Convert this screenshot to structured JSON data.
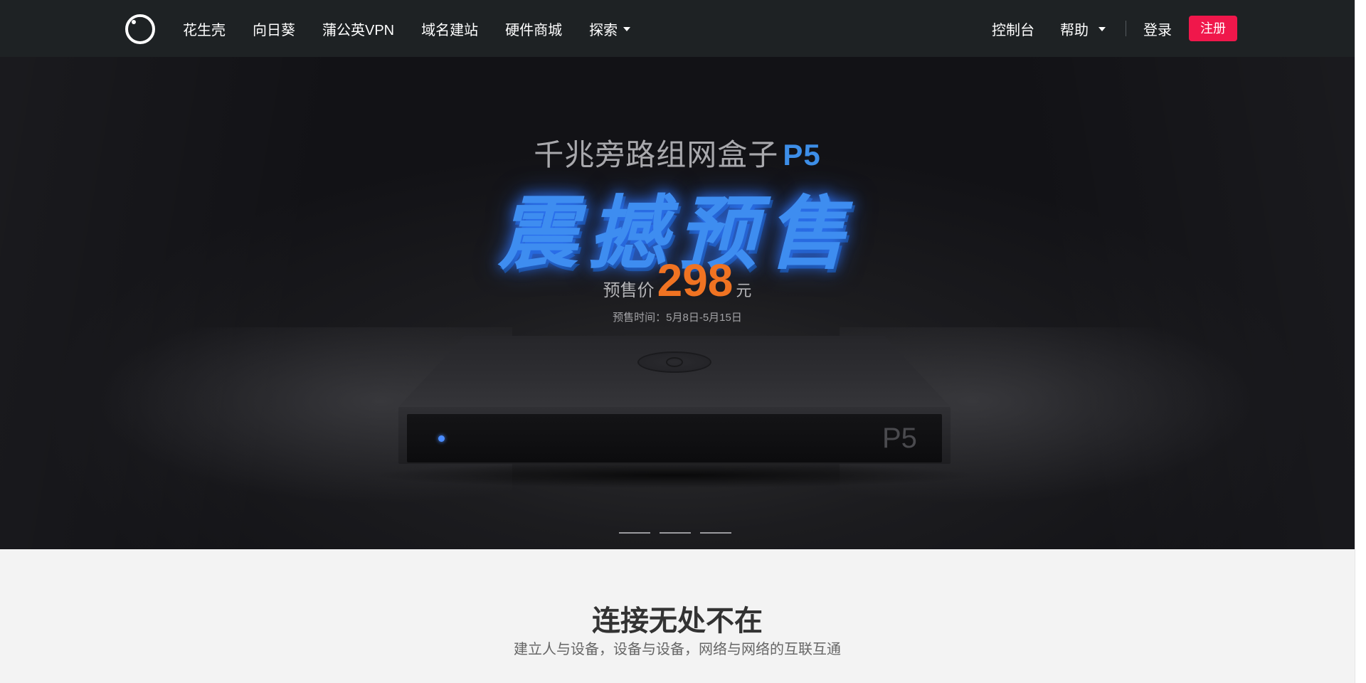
{
  "nav": {
    "items": [
      {
        "label": "花生壳"
      },
      {
        "label": "向日葵"
      },
      {
        "label": "蒲公英VPN"
      },
      {
        "label": "域名建站"
      },
      {
        "label": "硬件商城"
      },
      {
        "label": "探索"
      }
    ],
    "right": {
      "console": "控制台",
      "help": "帮助",
      "login": "登录",
      "register": "注册"
    }
  },
  "hero": {
    "subtitle": "千兆旁路组网盒子",
    "model": "P5",
    "headline": "震撼预售",
    "price_label": "预售价",
    "price_value": "298",
    "price_unit": "元",
    "period": "预售时间：5月8日-5月15日",
    "device_label": "P5",
    "slides": 3
  },
  "section": {
    "title": "连接无处不在",
    "subtitle": "建立人与设备，设备与设备，网络与网络的互联互通"
  },
  "colors": {
    "nav_bg": "#1e2224",
    "register_bg": "#f0174b",
    "accent_blue": "#3e8df0",
    "price_orange": "#f07322"
  }
}
